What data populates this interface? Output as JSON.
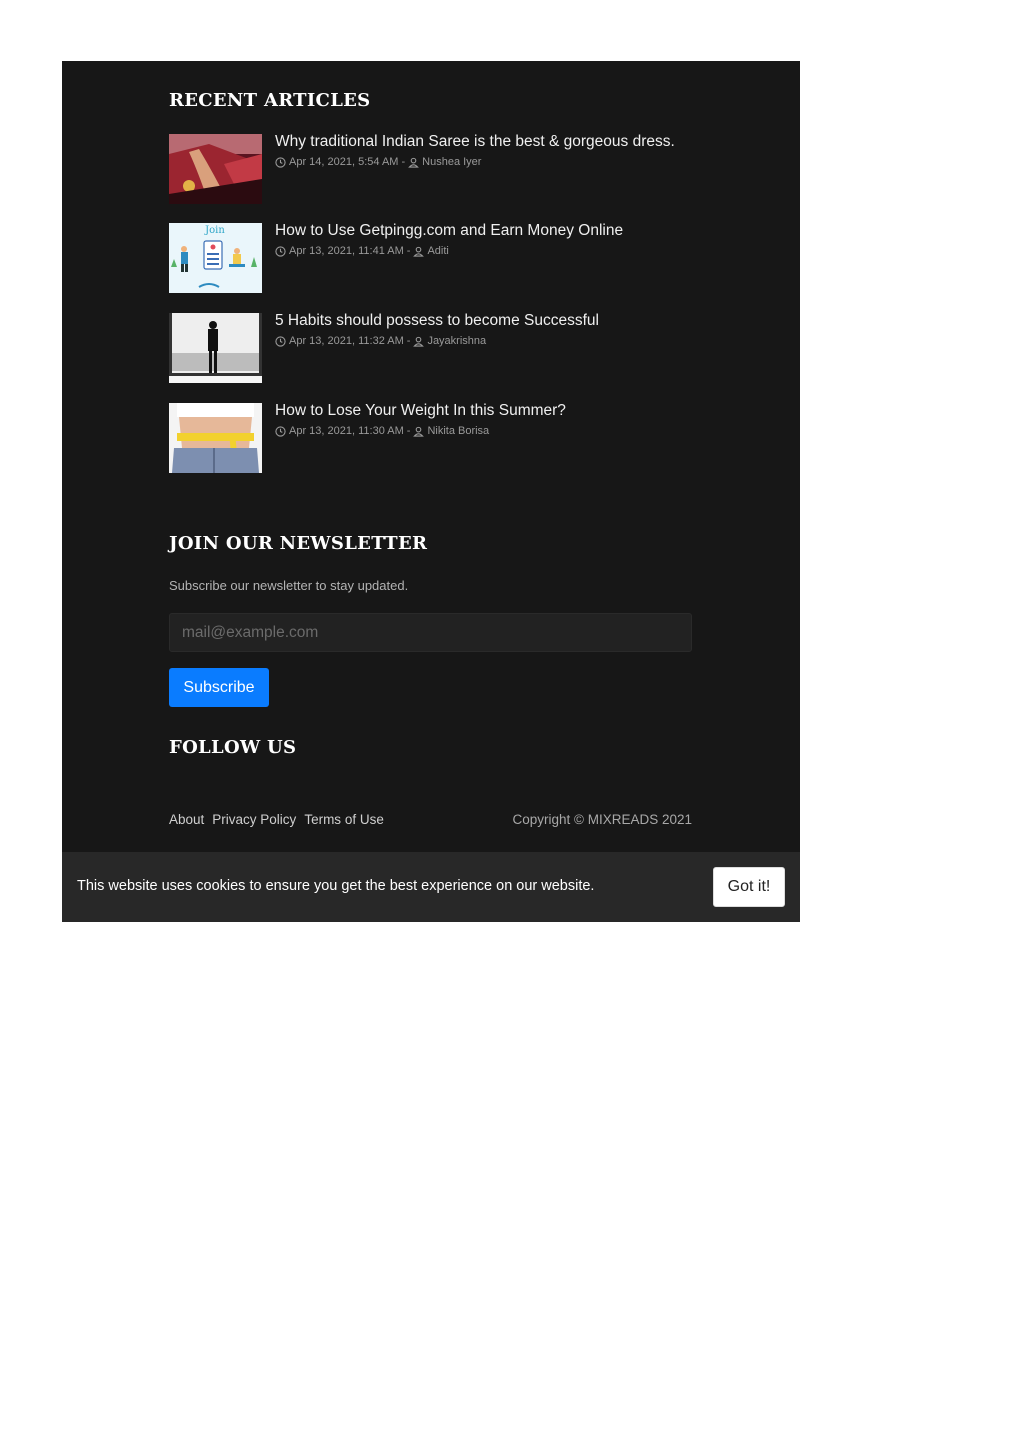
{
  "recent": {
    "heading": "RECENT ARTICLES",
    "articles": [
      {
        "title": "Why traditional Indian Saree is the best & gorgeous dress.",
        "date": "Apr 14, 2021, 5:54 AM",
        "separator": "-",
        "author": "Nushea Iyer",
        "thumb_icon": "saree-photo"
      },
      {
        "title": "How to Use Getpingg.com and Earn Money Online",
        "date": "Apr 13, 2021, 11:41 AM",
        "separator": "-",
        "author": "Aditi",
        "thumb_icon": "join-illustration",
        "thumb_text": "Join"
      },
      {
        "title": "5 Habits should possess to become Successful",
        "date": "Apr 13, 2021, 11:32 AM",
        "separator": "-",
        "author": "Jayakrishna",
        "thumb_icon": "man-at-window-photo"
      },
      {
        "title": "How to Lose Your Weight In this Summer?",
        "date": "Apr 13, 2021, 11:30 AM",
        "separator": "-",
        "author": "Nikita Borisa",
        "thumb_icon": "measuring-tape-photo"
      }
    ]
  },
  "newsletter": {
    "heading": "JOIN OUR NEWSLETTER",
    "description": "Subscribe our newsletter to stay updated.",
    "placeholder": "mail@example.com",
    "button_label": "Subscribe"
  },
  "follow": {
    "heading": "FOLLOW US"
  },
  "footer": {
    "links": [
      "About",
      "Privacy Policy",
      "Terms of Use"
    ],
    "copyright": "Copyright © MIXREADS 2021"
  },
  "cookie": {
    "text": "This website uses cookies to ensure you get the best experience on our website.",
    "button_label": "Got it!"
  },
  "colors": {
    "background": "#171717",
    "accent": "#0a7cff",
    "cookie_bar": "#282828"
  }
}
